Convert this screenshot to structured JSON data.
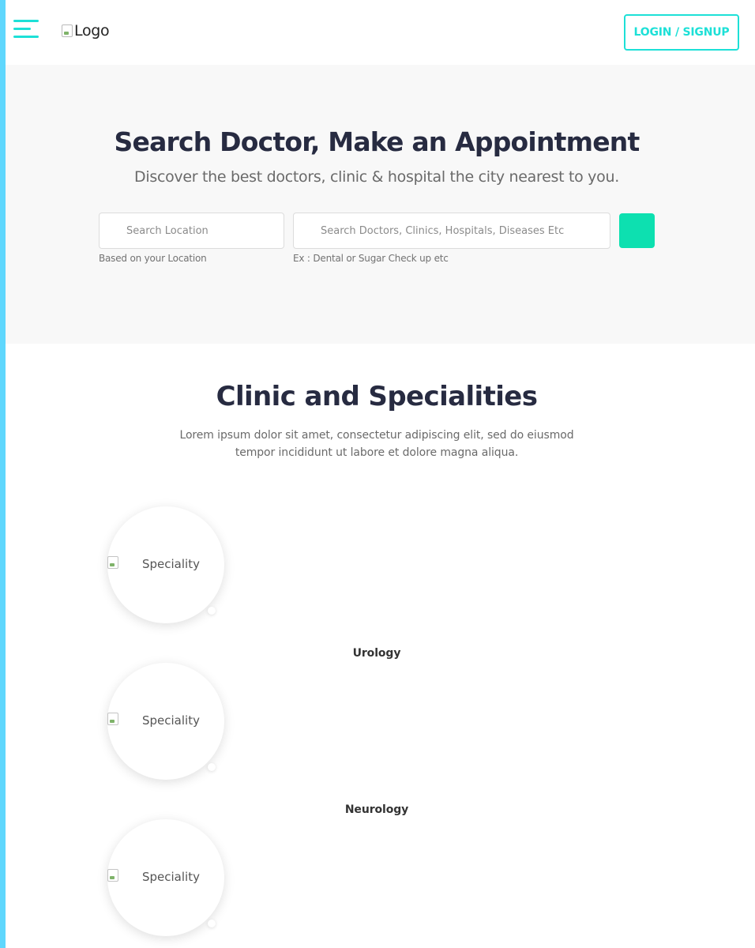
{
  "header": {
    "logo_alt": "Logo",
    "login_label": "LOGIN / SIGNUP",
    "accent_color": "#1de0d7"
  },
  "hero": {
    "title": "Search Doctor, Make an Appointment",
    "subtitle": "Discover the best doctors, clinic & hospital the city nearest to you.",
    "location_placeholder": "Search Location",
    "location_hint": "Based on your Location",
    "query_placeholder": "Search Doctors, Clinics, Hospitals, Diseases Etc",
    "query_hint": "Ex : Dental or Sugar Check up etc",
    "search_button_color": "#0de0b0"
  },
  "specialities": {
    "title": "Clinic and Specialities",
    "description_line1": "Lorem ipsum dolor sit amet, consectetur adipiscing elit, sed do eiusmod",
    "description_line2": "tempor incididunt ut labore et dolore magna aliqua.",
    "items": [
      {
        "image_alt": "Speciality",
        "name": "Urology"
      },
      {
        "image_alt": "Speciality",
        "name": "Neurology"
      },
      {
        "image_alt": "Speciality",
        "name": ""
      }
    ]
  }
}
